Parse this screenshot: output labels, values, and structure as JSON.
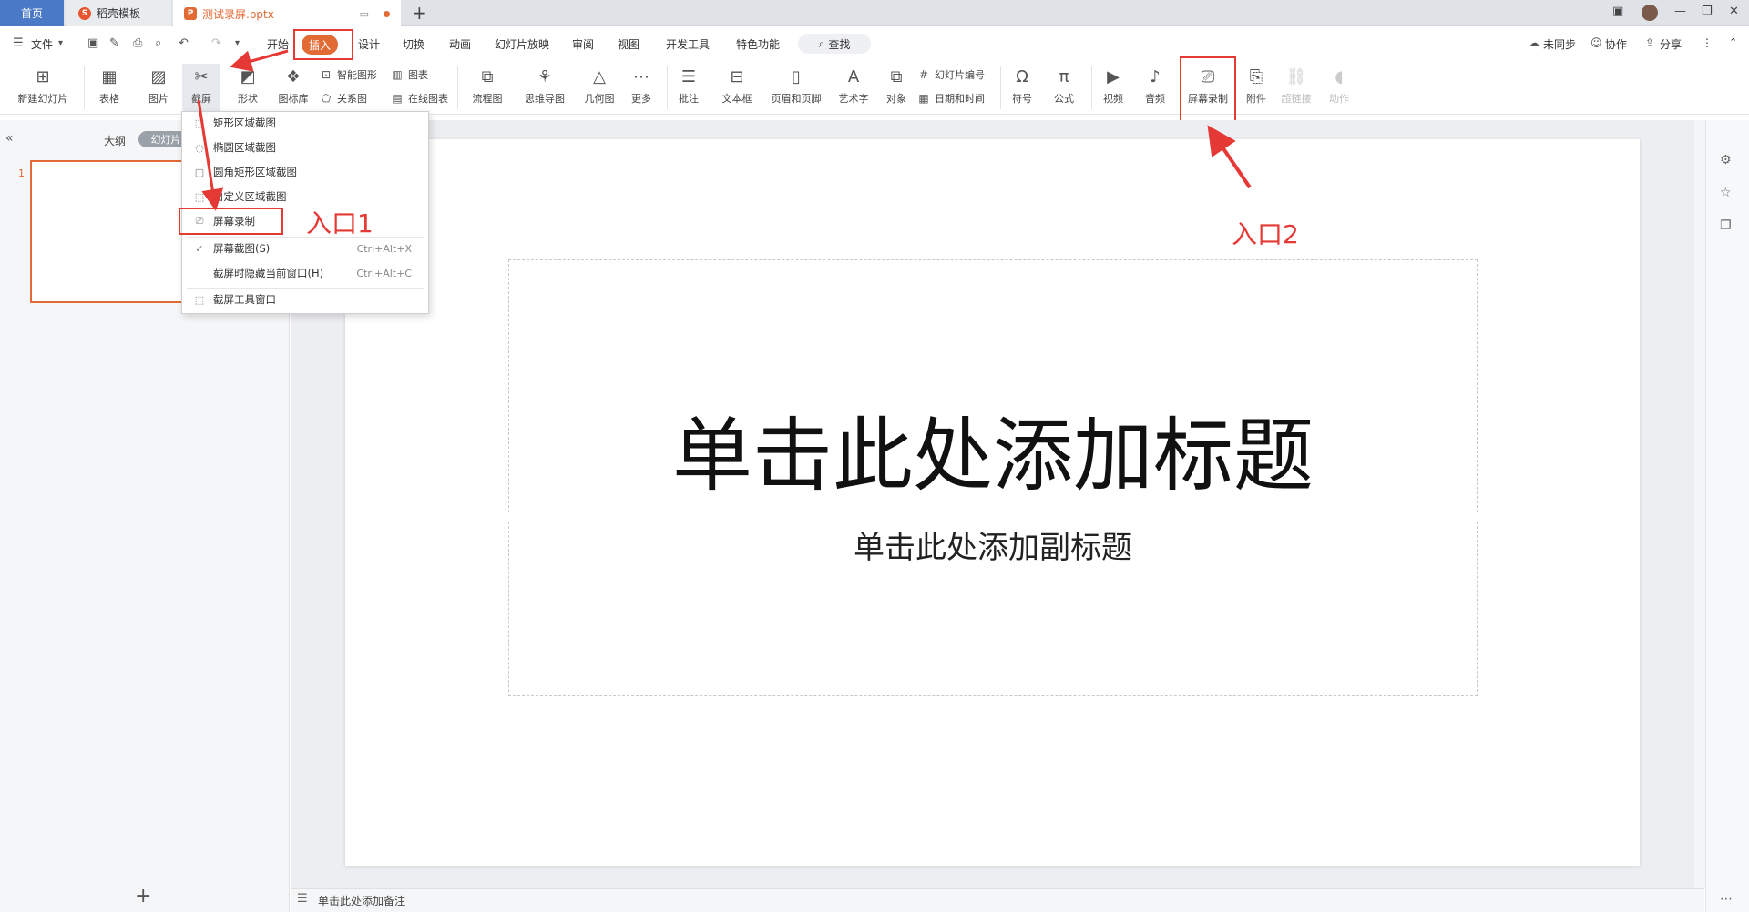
{
  "tabs": {
    "home": "首页",
    "templates": "稻壳模板",
    "document": "测试录屏.pptx",
    "new_tab": "+"
  },
  "menu": {
    "file": "文件",
    "items": [
      "开始",
      "插入",
      "设计",
      "切换",
      "动画",
      "幻灯片放映",
      "审阅",
      "视图",
      "开发工具",
      "特色功能"
    ],
    "active": "插入",
    "search": "查找",
    "right": {
      "sync": "未同步",
      "collab": "协作",
      "share": "分享"
    }
  },
  "ribbon": {
    "new_slide": "新建幻灯片",
    "table": "表格",
    "picture": "图片",
    "screenshot": "截屏",
    "shape": "形状",
    "icon_lib": "图标库",
    "smart_art": "智能图形",
    "relation": "关系图",
    "chart": "图表",
    "online_chart": "在线图表",
    "flowchart": "流程图",
    "mindmap": "思维导图",
    "geometry": "几何图",
    "more": "更多",
    "comment": "批注",
    "textbox": "文本框",
    "header_footer": "页眉和页脚",
    "wordart": "艺术字",
    "object": "对象",
    "slide_number": "幻灯片编号",
    "date_time": "日期和时间",
    "symbol": "符号",
    "formula": "公式",
    "video": "视频",
    "audio": "音频",
    "screen_record": "屏幕录制",
    "attachment": "附件",
    "hyperlink": "超链接",
    "action": "动作"
  },
  "left_panel": {
    "outline": "大纲",
    "slides": "幻灯片",
    "slide_number": "1",
    "add": "+"
  },
  "dropdown": {
    "items": [
      {
        "label": "矩形区域截图",
        "shortcut": ""
      },
      {
        "label": "椭圆区域截图",
        "shortcut": ""
      },
      {
        "label": "圆角矩形区域截图",
        "shortcut": ""
      },
      {
        "label": "自定义区域截图",
        "shortcut": ""
      },
      {
        "label": "屏幕录制",
        "shortcut": ""
      },
      {
        "label": "屏幕截图(S)",
        "shortcut": "Ctrl+Alt+X"
      },
      {
        "label": "截屏时隐藏当前窗口(H)",
        "shortcut": "Ctrl+Alt+C"
      },
      {
        "label": "截屏工具窗口",
        "shortcut": ""
      }
    ]
  },
  "slide": {
    "title_placeholder": "单击此处添加标题",
    "subtitle_placeholder": "单击此处添加副标题"
  },
  "notes": {
    "placeholder": "单击此处添加备注"
  },
  "annotations": {
    "entry1": "入口1",
    "entry2": "入口2"
  },
  "colors": {
    "accent": "#e26a35",
    "highlight": "#e53935",
    "home_tab": "#4a79c8"
  }
}
